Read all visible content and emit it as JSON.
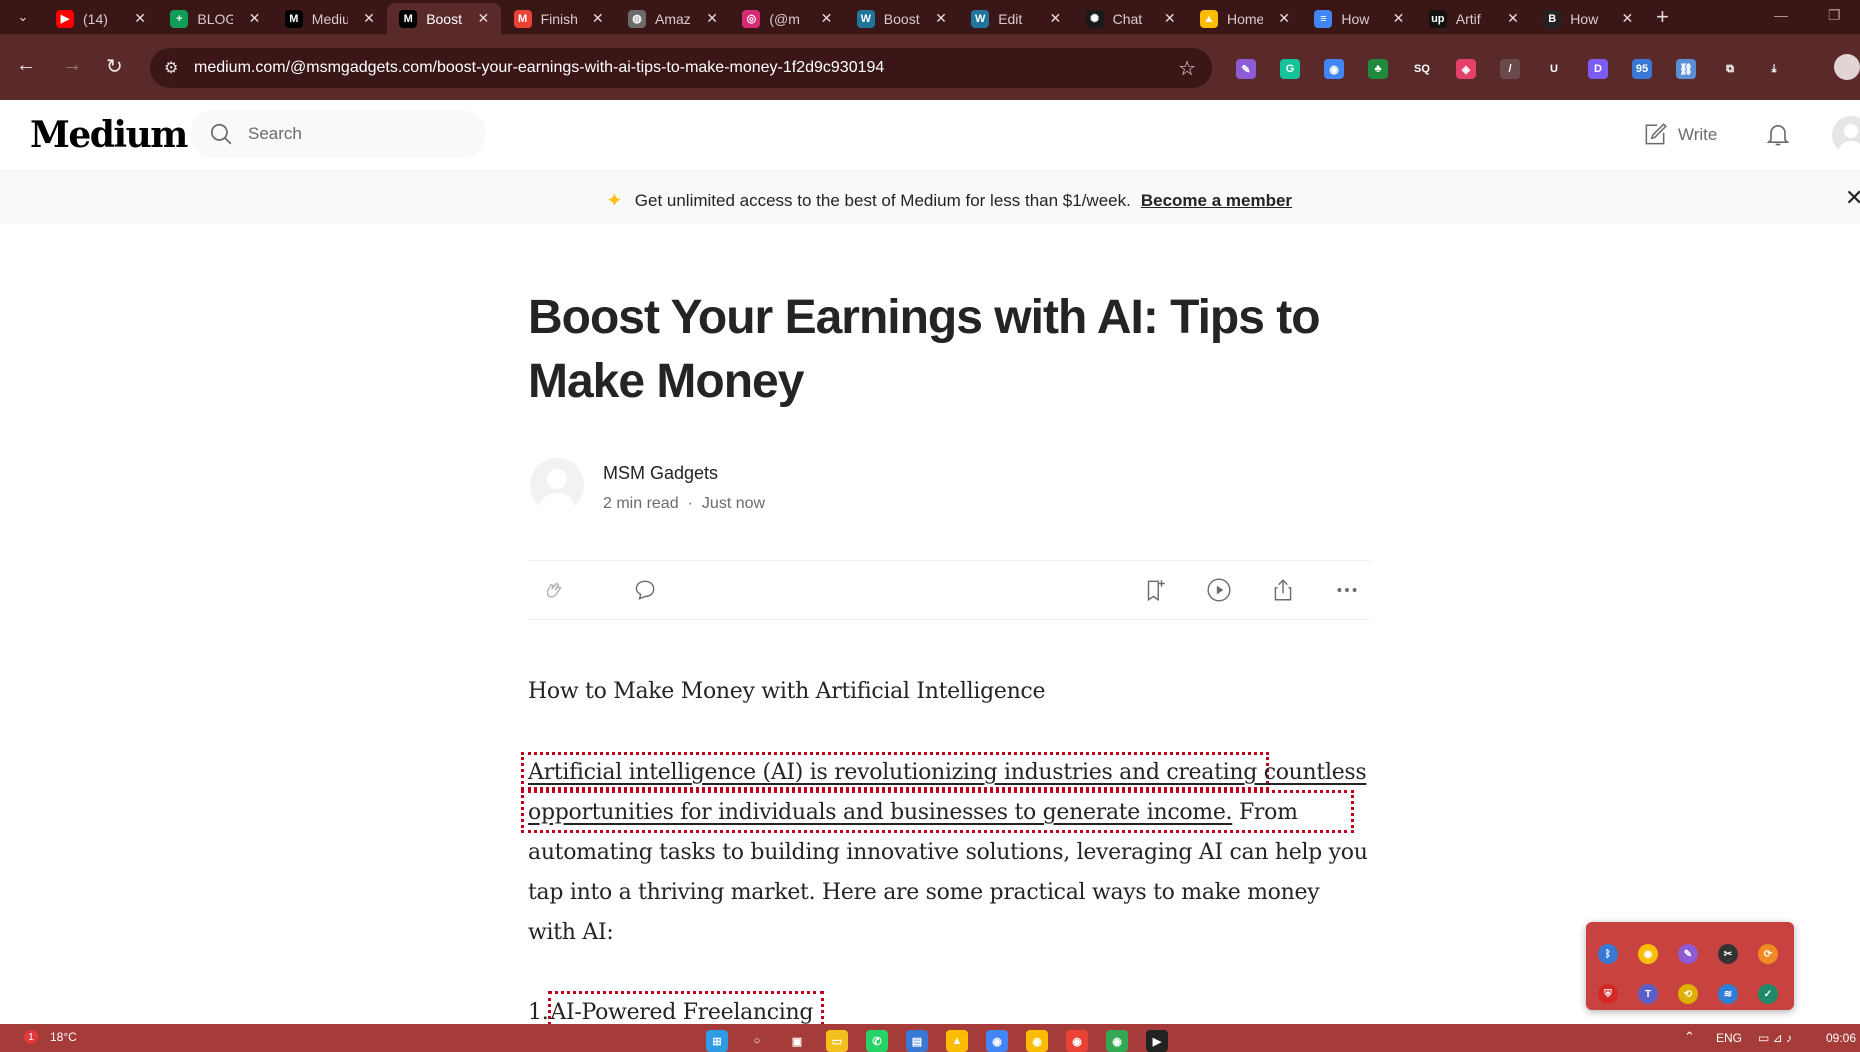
{
  "browser": {
    "tabs": [
      {
        "title": "(14)",
        "favicon": "youtube-icon",
        "color": "#ff0000",
        "glyph": "▶"
      },
      {
        "title": "BLOG",
        "favicon": "sheets-icon",
        "color": "#0f9d58",
        "glyph": "+"
      },
      {
        "title": "Medium",
        "favicon": "medium-icon",
        "color": "#000000",
        "glyph": "M"
      },
      {
        "title": "Boost",
        "favicon": "medium-icon",
        "color": "#000000",
        "glyph": "M",
        "active": true
      },
      {
        "title": "Finish",
        "favicon": "gmail-icon",
        "color": "#ea4335",
        "glyph": "M"
      },
      {
        "title": "Amazon",
        "favicon": "globe-icon",
        "color": "#6b6b6b",
        "glyph": "◍"
      },
      {
        "title": "(@m",
        "favicon": "instagram-icon",
        "color": "#d62976",
        "glyph": "◎"
      },
      {
        "title": "Boost",
        "favicon": "wordpress-icon",
        "color": "#21759b",
        "glyph": "W"
      },
      {
        "title": "Edit",
        "favicon": "wordpress-icon",
        "color": "#21759b",
        "glyph": "W"
      },
      {
        "title": "Chat",
        "favicon": "chatgpt-icon",
        "color": "#1a1a1a",
        "glyph": "✺"
      },
      {
        "title": "Home",
        "favicon": "drive-icon",
        "color": "#fbbc04",
        "glyph": "▲"
      },
      {
        "title": "How",
        "favicon": "docs-icon",
        "color": "#4285f4",
        "glyph": "≡"
      },
      {
        "title": "Artif",
        "favicon": "upwork-icon",
        "color": "#111111",
        "glyph": "up"
      },
      {
        "title": "How",
        "favicon": "blog-icon",
        "color": "#222222",
        "glyph": "B"
      }
    ],
    "url": "medium.com/@msmgadgets.com/boost-your-earnings-with-ai-tips-to-make-money-1f2d9c930194",
    "extensions": [
      {
        "name": "quill-extension-icon",
        "color": "#8e5bd6",
        "glyph": "✎"
      },
      {
        "name": "grammarly-icon",
        "color": "#15c39a",
        "glyph": "G"
      },
      {
        "name": "google-lens-icon",
        "color": "#4285f4",
        "glyph": "◉"
      },
      {
        "name": "evergreen-extension-icon",
        "color": "#1f8a3a",
        "glyph": "♣"
      },
      {
        "name": "seo-extension-icon",
        "color": "#5a2a2b",
        "glyph": "SQ"
      },
      {
        "name": "screen-capture-icon",
        "color": "#e3406a",
        "glyph": "◈"
      },
      {
        "name": "slash-extension-icon",
        "color": "#6b4a4b",
        "glyph": "/"
      },
      {
        "name": "underline-extension-icon",
        "color": "#5a2a2b",
        "glyph": "U"
      },
      {
        "name": "d-extension-icon",
        "color": "#7b5cf5",
        "glyph": "D"
      },
      {
        "name": "score-extension-icon",
        "color": "#3a78d6",
        "glyph": "95"
      },
      {
        "name": "link-extension-icon",
        "color": "#5a8fd6",
        "glyph": "⛓"
      },
      {
        "name": "puzzle-extensions-icon",
        "color": "#5a2a2b",
        "glyph": "⧉"
      },
      {
        "name": "download-icon",
        "color": "#5a2a2b",
        "glyph": "⤓"
      }
    ]
  },
  "medium": {
    "logo": "Medium",
    "search_placeholder": "Search",
    "write_label": "Write",
    "banner_text": "Get unlimited access to the best of Medium for less than $1/week.",
    "banner_link": "Become a member"
  },
  "article": {
    "title": "Boost Your Earnings with AI: Tips to Make Money",
    "author": "MSM Gadgets",
    "read_time": "2 min read",
    "published": "Just now",
    "p1": "How to Make Money with Artificial Intelligence",
    "p2_highlight": "Artificial intelligence (AI) is revolutionizing industries and creating countless opportunities for individuals and businesses to generate income.",
    "p2_rest": " From automating tasks to building innovative solutions, leveraging AI can help you tap into a thriving market. Here are some practical ways to make money with AI:",
    "list_num": "1.",
    "list_item_1": "AI-Powered Freelancing"
  },
  "tray_popup": [
    {
      "name": "bluetooth-tray-icon",
      "color": "#3a78d6",
      "glyph": "ᛒ"
    },
    {
      "name": "chrome-tray-icon",
      "color": "#fbbc04",
      "glyph": "◉"
    },
    {
      "name": "quill-tray-icon",
      "color": "#8e5bd6",
      "glyph": "✎"
    },
    {
      "name": "capture-tray-icon",
      "color": "#333333",
      "glyph": "✂"
    },
    {
      "name": "update-tray-icon",
      "color": "#f08a24",
      "glyph": "⟳"
    },
    {
      "name": "security-tray-icon",
      "color": "#d62828",
      "glyph": "⛨"
    },
    {
      "name": "teams-tray-icon",
      "color": "#5b5fc7",
      "glyph": "T"
    },
    {
      "name": "sync-tray-icon",
      "color": "#e0b000",
      "glyph": "⟲"
    },
    {
      "name": "network-tray-icon",
      "color": "#2f7fd6",
      "glyph": "≋"
    },
    {
      "name": "defender-tray-icon",
      "color": "#1f8a6a",
      "glyph": "✓"
    }
  ],
  "taskbar": {
    "notification_count": "1",
    "temperature": "18°C",
    "apps": [
      {
        "name": "start-icon",
        "color": "#2f9be6",
        "glyph": "⊞"
      },
      {
        "name": "search-taskbar-icon",
        "color": "#a63c3a",
        "glyph": "○"
      },
      {
        "name": "task-view-icon",
        "color": "#a63c3a",
        "glyph": "▣"
      },
      {
        "name": "file-explorer-icon",
        "color": "#f4c01e",
        "glyph": "▭"
      },
      {
        "name": "whatsapp-icon",
        "color": "#25d366",
        "glyph": "✆"
      },
      {
        "name": "store-icon",
        "color": "#3a78d6",
        "glyph": "▤"
      },
      {
        "name": "drive-taskbar-icon",
        "color": "#fbbc04",
        "glyph": "▲"
      },
      {
        "name": "chrome-profile-1-icon",
        "color": "#4285f4",
        "glyph": "◉"
      },
      {
        "name": "chrome-profile-2-icon",
        "color": "#fbbc04",
        "glyph": "◉"
      },
      {
        "name": "chrome-profile-3-icon",
        "color": "#ea4335",
        "glyph": "◉"
      },
      {
        "name": "chrome-profile-4-icon",
        "color": "#34a853",
        "glyph": "◉"
      },
      {
        "name": "media-player-icon",
        "color": "#222222",
        "glyph": "▶"
      }
    ],
    "language": "ENG",
    "time": "09:06"
  }
}
